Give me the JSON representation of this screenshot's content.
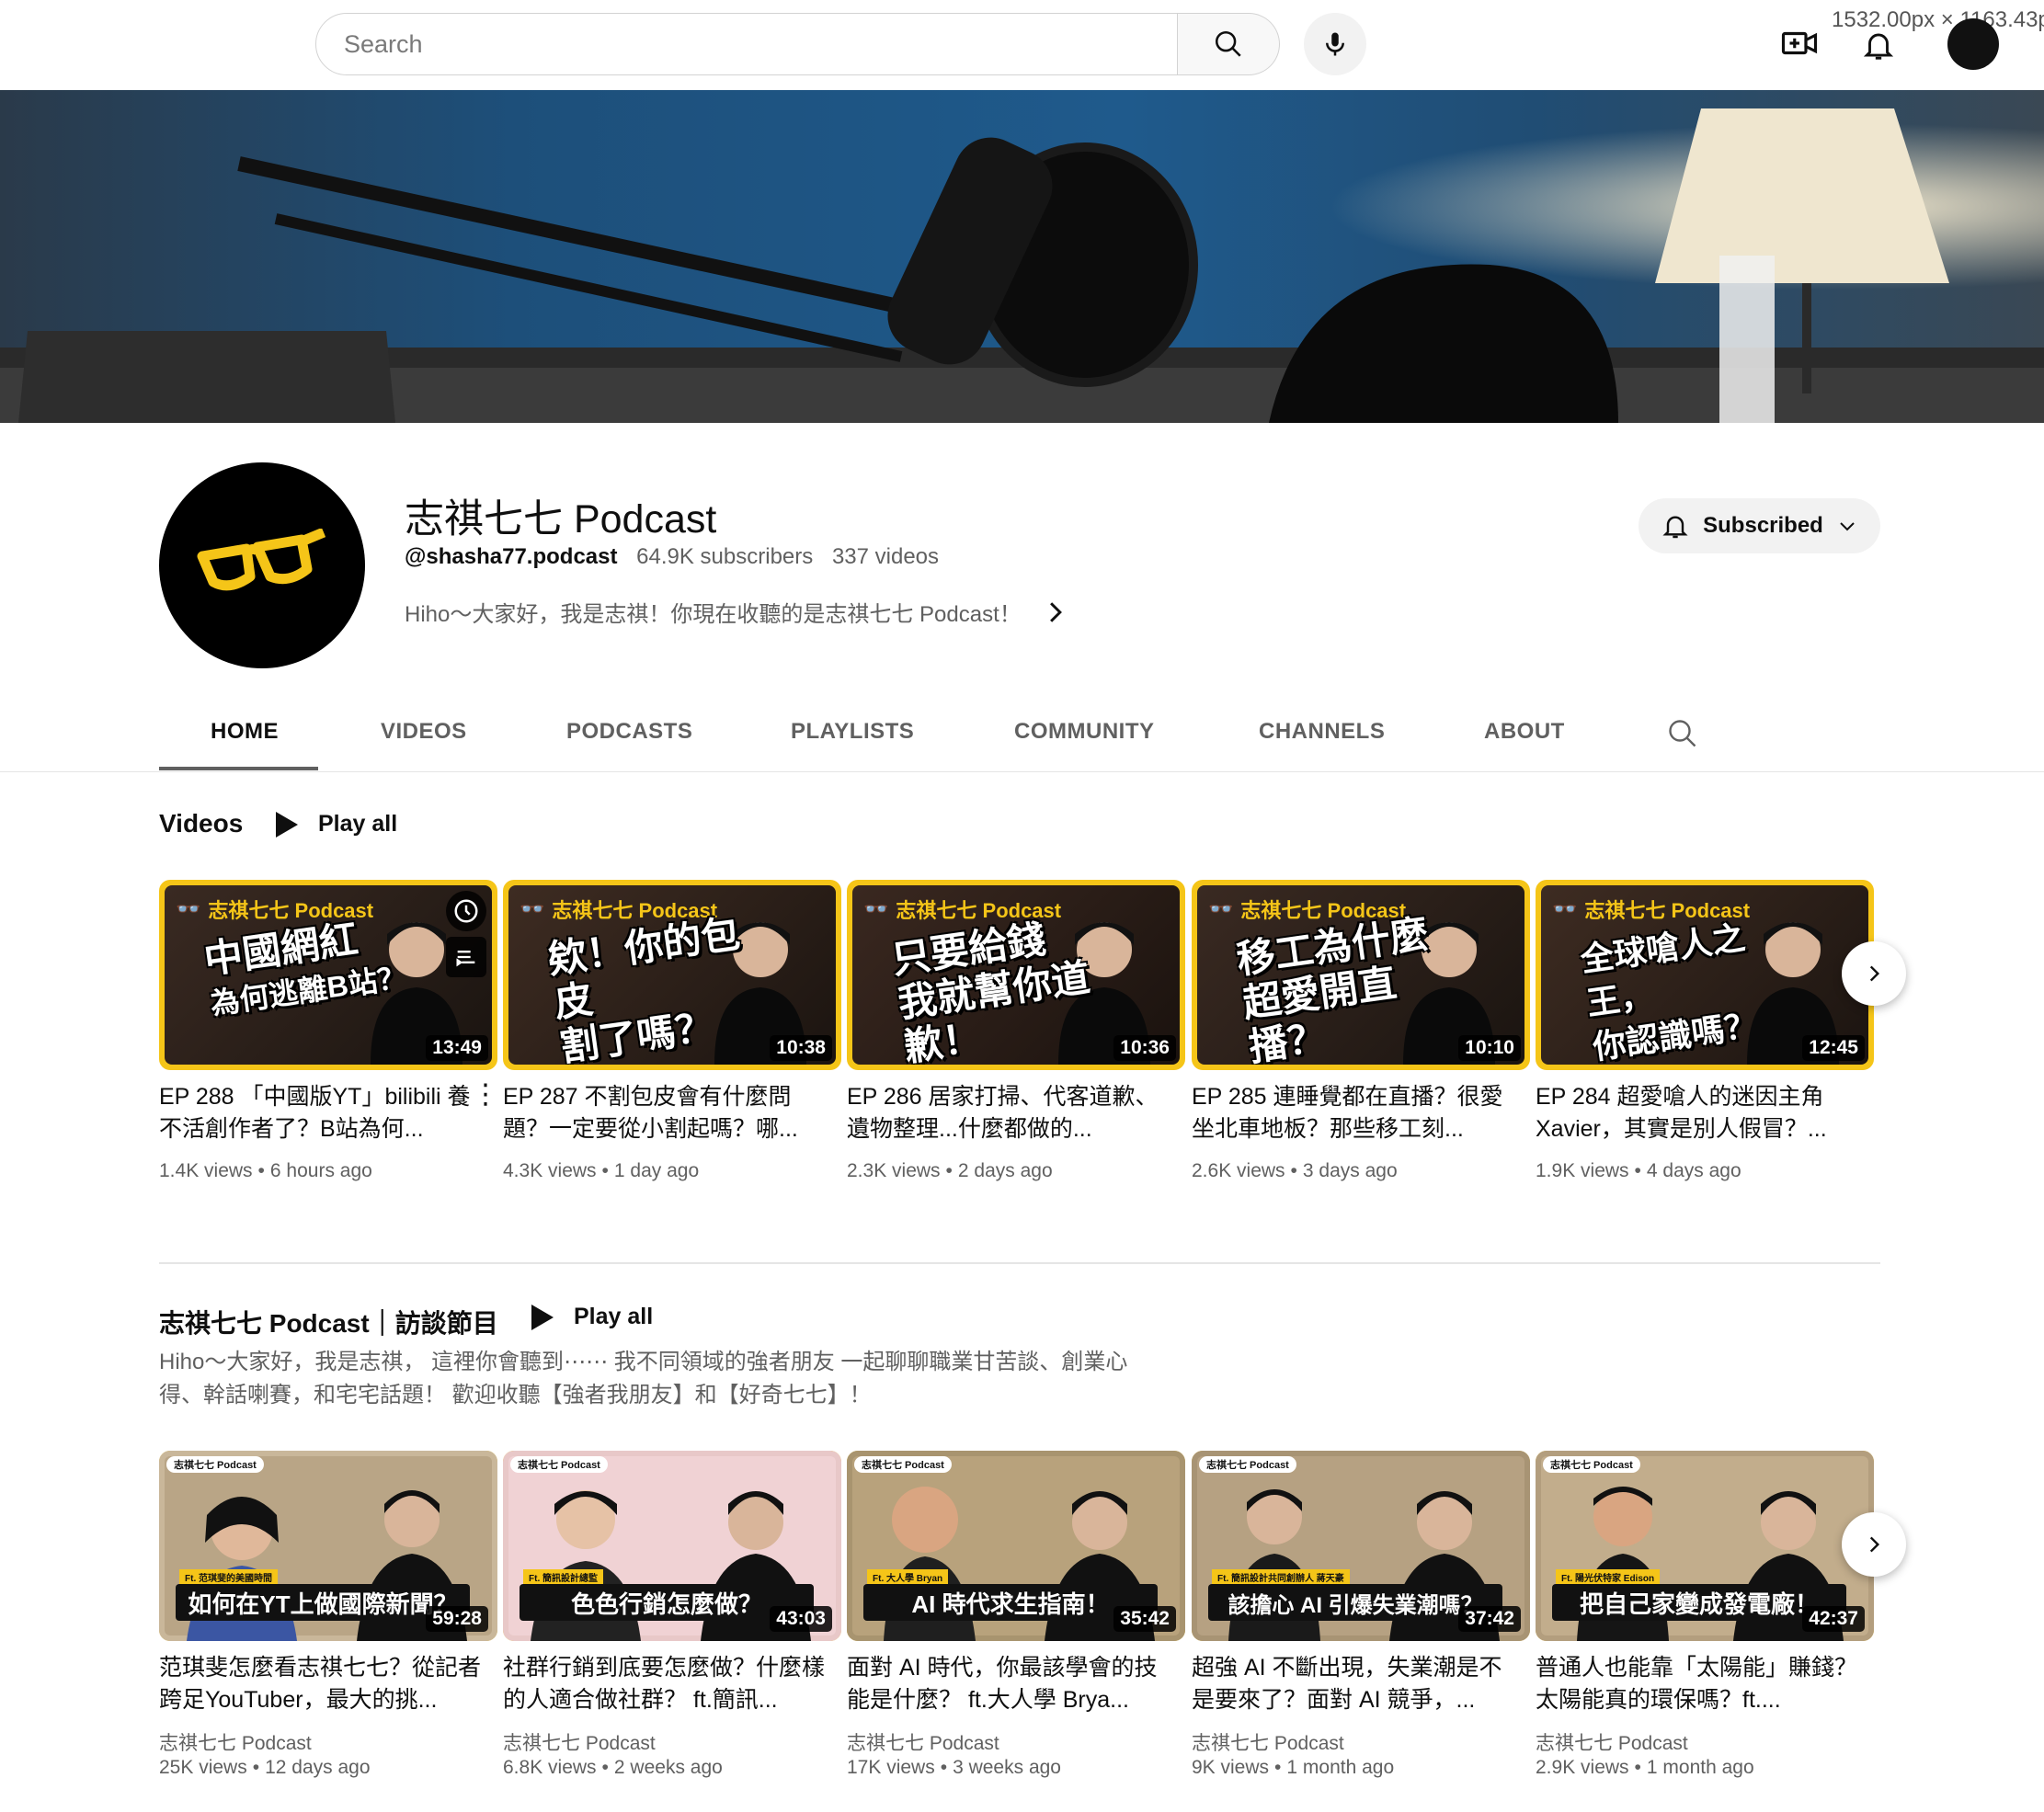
{
  "header": {
    "search_placeholder": "Search",
    "dimension_readout": "1532.00px × 1163.43p",
    "icons": [
      "search-icon",
      "mic-icon",
      "create-video-icon",
      "bell-icon"
    ]
  },
  "channel": {
    "name": "志祺七七 Podcast",
    "handle": "@shasha77.podcast",
    "subscribers": "64.9K subscribers",
    "video_count": "337 videos",
    "description": "Hiho～大家好，我是志祺！你現在收聽的是志祺七七 Podcast！",
    "subscribe_label": "Subscribed",
    "accent_color": "#f5c518"
  },
  "tabs": [
    {
      "label": "HOME",
      "active": true
    },
    {
      "label": "VIDEOS",
      "active": false
    },
    {
      "label": "PODCASTS",
      "active": false
    },
    {
      "label": "PLAYLISTS",
      "active": false
    },
    {
      "label": "COMMUNITY",
      "active": false
    },
    {
      "label": "CHANNELS",
      "active": false
    },
    {
      "label": "ABOUT",
      "active": false
    }
  ],
  "videos_shelf": {
    "title": "Videos",
    "play_all": "Play all",
    "items": [
      {
        "thumb_logo": "志祺七七 Podcast",
        "thumb_line1": "中國網紅",
        "thumb_line2": "為何逃離B站？",
        "duration": "13:49",
        "title": "EP 288 「中國版YT」bilibili 養不活創作者了？B站為何...",
        "views": "1.4K views",
        "age": "6 hours ago"
      },
      {
        "thumb_logo": "志祺七七 Podcast",
        "thumb_line1": "欸！你的包皮",
        "thumb_line2": "割了嗎？",
        "duration": "10:38",
        "title": "EP 287 不割包皮會有什麼問題？一定要從小割起嗎？哪...",
        "views": "4.3K views",
        "age": "1 day ago"
      },
      {
        "thumb_logo": "志祺七七 Podcast",
        "thumb_line1": "只要給錢",
        "thumb_line2": "我就幫你道歉！",
        "duration": "10:36",
        "title": "EP 286 居家打掃、代客道歉、遺物整理...什麼都做的...",
        "views": "2.3K views",
        "age": "2 days ago"
      },
      {
        "thumb_logo": "志祺七七 Podcast",
        "thumb_line1": "移工為什麼",
        "thumb_line2": "超愛開直播？",
        "duration": "10:10",
        "title": "EP 285 連睡覺都在直播？很愛坐北車地板？那些移工刻...",
        "views": "2.6K views",
        "age": "3 days ago"
      },
      {
        "thumb_logo": "志祺七七 Podcast",
        "thumb_line1": "全球嗆人之王，",
        "thumb_line2": "你認識嗎？",
        "duration": "12:45",
        "title": "EP 284 超愛嗆人的迷因主角 Xavier，其實是別人假冒？...",
        "views": "1.9K views",
        "age": "4 days ago"
      }
    ]
  },
  "interview_shelf": {
    "title": "志祺七七 Podcast｜訪談節目",
    "play_all": "Play all",
    "description": "Hiho～大家好，我是志祺， 這裡你會聽到⋯⋯ 我不同領域的強者朋友 一起聊聊職業甘苦談、創業心得、幹話喇賽，和宅宅話題！ 歡迎收聽【強者我朋友】和【好奇七七】！",
    "items": [
      {
        "thumb_logo": "志祺七七 Podcast",
        "guest_tag": "Ft. 范琪斐的美國時間",
        "caption": "如何在YT上做國際新聞？",
        "duration": "59:28",
        "title": "范琪斐怎麼看志祺七七？從記者跨足YouTuber，最大的挑...",
        "channel": "志祺七七 Podcast",
        "views": "25K views",
        "age": "12 days ago"
      },
      {
        "thumb_logo": "志祺七七 Podcast",
        "guest_tag": "Ft. 簡訊設計總監",
        "caption": "色色行銷怎麼做？",
        "duration": "43:03",
        "title": "社群行銷到底要怎麼做？什麼樣的人適合做社群？ ft.簡訊...",
        "channel": "志祺七七 Podcast",
        "views": "6.8K views",
        "age": "2 weeks ago"
      },
      {
        "thumb_logo": "志祺七七 Podcast",
        "guest_tag": "Ft. 大人學 Bryan",
        "caption": "AI 時代求生指南！",
        "duration": "35:42",
        "title": "面對 AI 時代，你最該學會的技能是什麼？ ft.大人學 Brya...",
        "channel": "志祺七七 Podcast",
        "views": "17K views",
        "age": "3 weeks ago"
      },
      {
        "thumb_logo": "志祺七七 Podcast",
        "guest_tag": "Ft. 簡訊設計共同創辦人 蔣天豪",
        "caption": "該擔心 AI 引爆失業潮嗎？",
        "duration": "37:42",
        "title": "超強 AI 不斷出現，失業潮是不是要來了？面對 AI 競爭，...",
        "channel": "志祺七七 Podcast",
        "views": "9K views",
        "age": "1 month ago"
      },
      {
        "thumb_logo": "志祺七七 Podcast",
        "guest_tag": "Ft. 陽光伏特家 Edison",
        "caption": "把自己家變成發電廠！",
        "duration": "42:37",
        "title": "普通人也能靠「太陽能」賺錢？太陽能真的環保嗎？ft....",
        "channel": "志祺七七 Podcast",
        "views": "2.9K views",
        "age": "1 month ago"
      }
    ]
  },
  "separator": "•"
}
